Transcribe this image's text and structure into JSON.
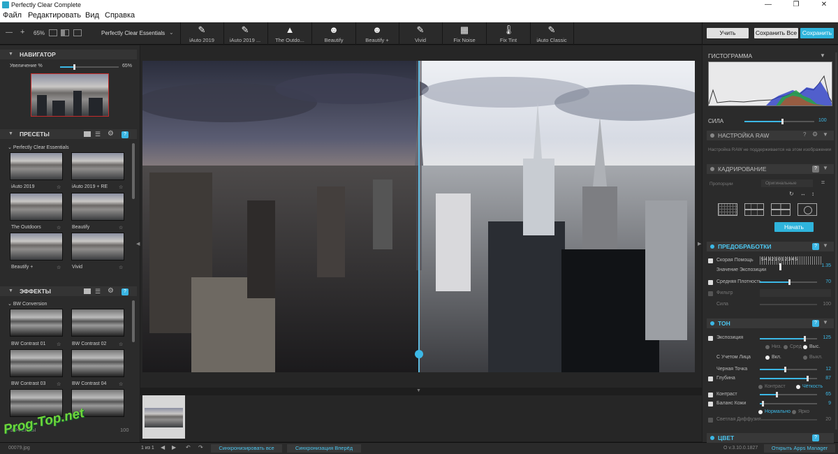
{
  "window": {
    "title": "Perfectly Clear Complete",
    "min": "—",
    "max": "❐",
    "close": "✕"
  },
  "menu": [
    "Файл",
    "Редактировать",
    "Вид",
    "Справка"
  ],
  "toolbar": {
    "zoom_minus": "—",
    "zoom_plus": "+",
    "zoom_value": "65%",
    "preset_name": "Perfectly Clear Essentials",
    "presets": [
      {
        "label": "iAuto 2019",
        "icon": "brush-2019-icon",
        "glyph": "✎"
      },
      {
        "label": "iAuto 2019 ...",
        "icon": "brush-2019-re-icon",
        "glyph": "✎"
      },
      {
        "label": "The Outdo...",
        "icon": "landscape-icon",
        "glyph": "▲"
      },
      {
        "label": "Beautify",
        "icon": "face-icon",
        "glyph": "☻"
      },
      {
        "label": "Beautify +",
        "icon": "face-plus-icon",
        "glyph": "☻"
      },
      {
        "label": "Vivid",
        "icon": "brush-icon",
        "glyph": "✎"
      },
      {
        "label": "Fix Noise",
        "icon": "noise-icon",
        "glyph": "▦"
      },
      {
        "label": "Fix Tint",
        "icon": "thermometer-icon",
        "glyph": "🌡"
      },
      {
        "label": "iAuto Classic",
        "icon": "brush-hd-icon",
        "glyph": "✎"
      }
    ],
    "learn": "Учить",
    "save_all": "Сохранить Все",
    "save": "Сохранить"
  },
  "navigator": {
    "title": "НАВИГАТОР",
    "zoom_label": "Увеличение %",
    "zoom_value": "65%",
    "zoom": 0.65
  },
  "presets_panel": {
    "title": "ПРЕСЕТЫ",
    "group": "Perfectly Clear Essentials",
    "items": [
      "iAuto 2019",
      "iAuto 2019 + RE",
      "The Outdoors",
      "Beautify",
      "Beautify +",
      "Vivid"
    ]
  },
  "effects_panel": {
    "title": "ЭФФЕКТЫ",
    "group": "BW Conversion",
    "items": [
      "BW Contrast 01",
      "BW Contrast 02",
      "BW Contrast 03",
      "BW Contrast 04",
      "",
      ""
    ],
    "footer_label": "ЭФФЕКТЫ",
    "footer_value": "100"
  },
  "watermark": "Prog-Top.net",
  "right": {
    "histogram_title": "ГИСТОГРАММА",
    "strength_label": "СИЛА",
    "strength_value": "100",
    "raw_title": "НАСТРОЙКА RAW",
    "raw_note": "Настройка RAW не поддерживается на этом изображении",
    "crop_title": "КАДРИРОВАНИЕ",
    "crop_prop_label": "Пропорции",
    "crop_prop_value": "Оригинальные",
    "crop_start": "Начать",
    "pre_title": "ПРЕДОБРАБОТКИ",
    "quick_help": "Скорая Помощь",
    "quick_scale": "5  4  3  2  1  0  1  2  3  4  5",
    "exposure_value_label": "Значение Экспозиции",
    "exposure_value": "1.35",
    "mid_density": "Средняя Плотность",
    "mid_density_value": "70",
    "filter": "Фильтр",
    "strength2": "Сила",
    "strength2_value": "100",
    "tone_title": "ТОН",
    "exposure": "Экспозиция",
    "exposure_val": "125",
    "low": "Низ.",
    "mid": "Сред",
    "high": "Выс.",
    "face_aware": "С Учетом Лица",
    "on": "Вкл.",
    "off": "Выкл.",
    "black_point": "Черная Точка",
    "black_point_val": "12",
    "depth": "Глубина",
    "depth_val": "87",
    "contrast_opt": "Контраст",
    "clarity_opt": "Чёткость",
    "contrast": "Контраст",
    "contrast_val": "65",
    "skin_balance": "Баланс Кожи",
    "skin_val": "9",
    "normal": "Нормально",
    "bright": "Ярко",
    "light_diffusion": "Светлая Диффузия",
    "light_diffusion_val": "20",
    "color_title": "ЦВЕТ"
  },
  "status": {
    "file": "00079.jpg",
    "pages": "1 из 1",
    "sync_all": "Синхронизировать все",
    "sync_forward": "Синхронизация Вперёд",
    "version": "О v.3.10.0.1827",
    "apps": "Открыть Apps Manager"
  },
  "colors": {
    "accent": "#3cb8e6",
    "panel": "#2b2b2b"
  }
}
